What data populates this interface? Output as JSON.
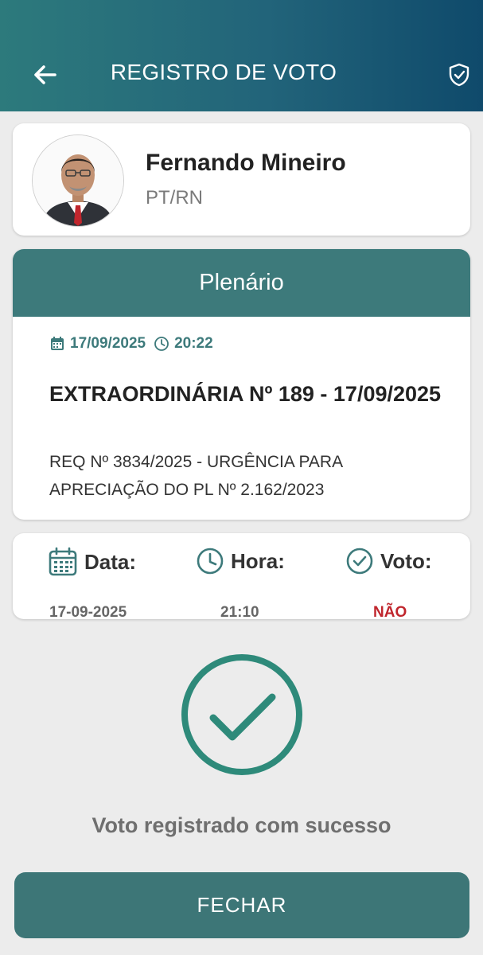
{
  "header": {
    "title": "REGISTRO DE VOTO",
    "back_icon": "arrow-left-icon",
    "shield_icon": "shield-check-icon"
  },
  "profile": {
    "name": "Fernando Mineiro",
    "party": "PT/RN"
  },
  "session": {
    "header": "Plenário",
    "date": "17/09/2025",
    "time": "20:22",
    "title": "EXTRAORDINÁRIA Nº 189 - 17/09/2025",
    "description": "REQ Nº 3834/2025 - URGÊNCIA PARA APRECIAÇÃO DO PL Nº 2.162/2023"
  },
  "vote_info": {
    "date_label": "Data:",
    "date_value": "17-09-2025",
    "time_label": "Hora:",
    "time_value": "21:10",
    "vote_label": "Voto:",
    "vote_value": "NÃO"
  },
  "success": {
    "message": "Voto registrado com sucesso"
  },
  "actions": {
    "close_label": "FECHAR"
  },
  "colors": {
    "accent": "#3d7a7b",
    "success": "#2e8a7a",
    "vote_no": "#c0262d"
  }
}
